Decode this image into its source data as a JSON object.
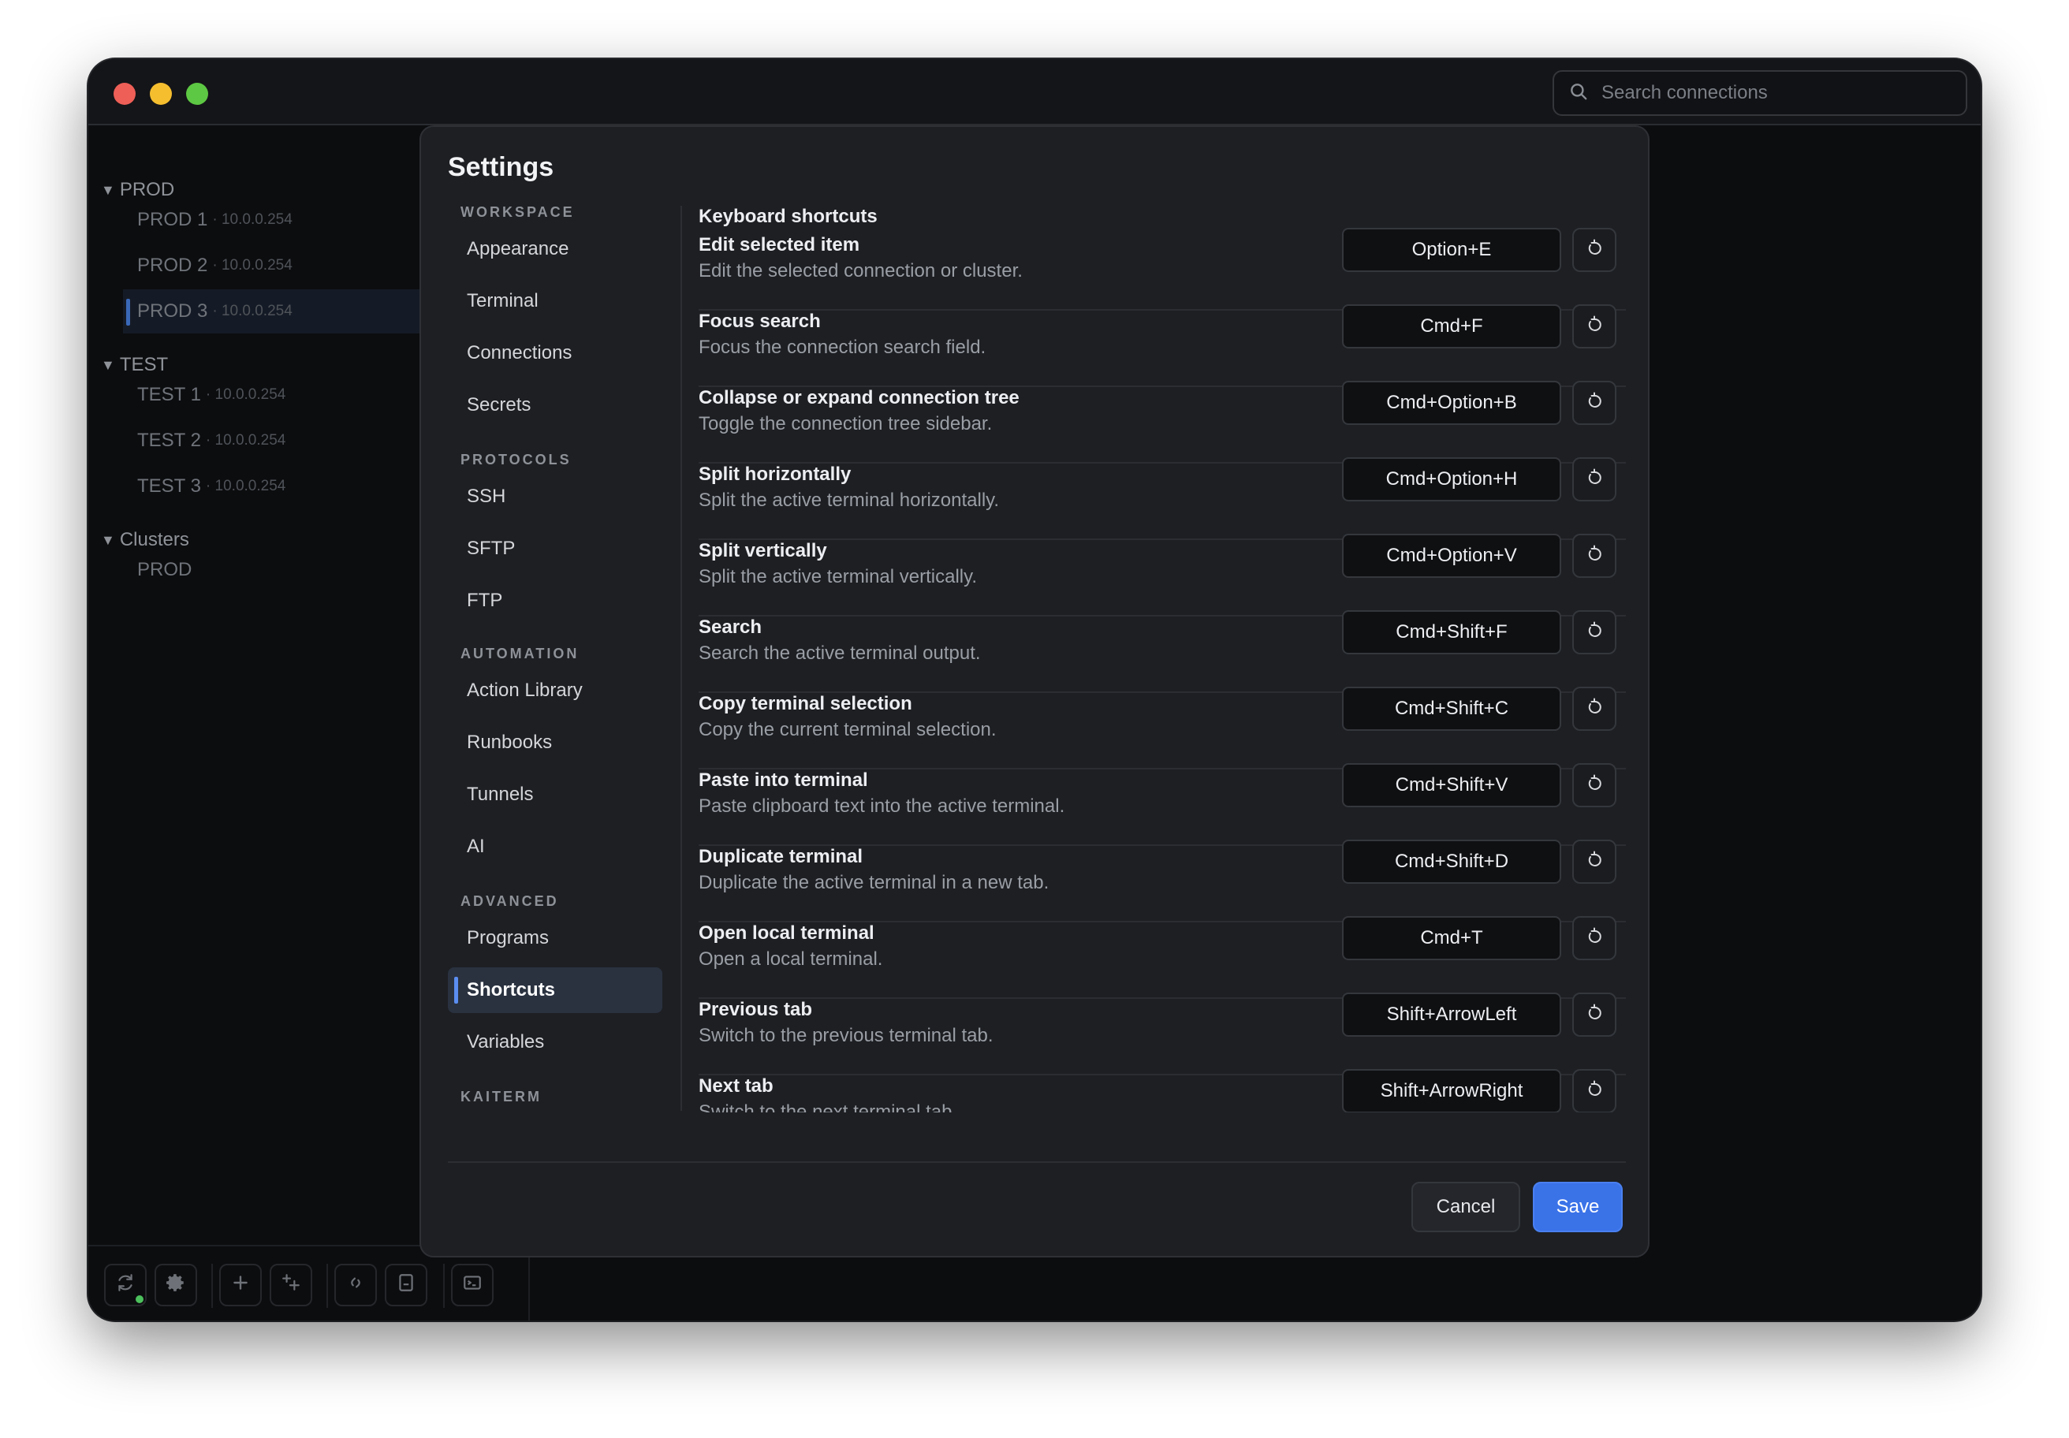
{
  "search": {
    "placeholder": "Search connections"
  },
  "tree": {
    "groups": [
      {
        "label": "PROD",
        "items": [
          {
            "name": "PROD 1",
            "ip": "· 10.0.0.254"
          },
          {
            "name": "PROD 2",
            "ip": "· 10.0.0.254"
          },
          {
            "name": "PROD 3",
            "ip": "· 10.0.0.254"
          }
        ]
      },
      {
        "label": "TEST",
        "items": [
          {
            "name": "TEST 1",
            "ip": "· 10.0.0.254"
          },
          {
            "name": "TEST 2",
            "ip": "· 10.0.0.254"
          },
          {
            "name": "TEST 3",
            "ip": "· 10.0.0.254"
          }
        ]
      },
      {
        "label": "Clusters",
        "items": [
          {
            "name": "PROD",
            "ip": ""
          }
        ]
      }
    ],
    "active_item": "PROD 3"
  },
  "settings": {
    "title": "Settings",
    "nav": {
      "workspace_label": "WORKSPACE",
      "workspace": [
        "Appearance",
        "Terminal",
        "Connections",
        "Secrets"
      ],
      "protocols_label": "PROTOCOLS",
      "protocols": [
        "SSH",
        "SFTP",
        "FTP"
      ],
      "automation_label": "AUTOMATION",
      "automation": [
        "Action Library",
        "Runbooks",
        "Tunnels",
        "AI"
      ],
      "advanced_label": "ADVANCED",
      "advanced": [
        "Programs",
        "Shortcuts",
        "Variables"
      ],
      "kaiterm_label": "KAITERM",
      "active": "Shortcuts"
    },
    "content": {
      "heading": "Keyboard shortcuts",
      "shortcuts": [
        {
          "title": "Edit selected item",
          "desc": "Edit the selected connection or cluster.",
          "key": "Option+E"
        },
        {
          "title": "Focus search",
          "desc": "Focus the connection search field.",
          "key": "Cmd+F"
        },
        {
          "title": "Collapse or expand connection tree",
          "desc": "Toggle the connection tree sidebar.",
          "key": "Cmd+Option+B"
        },
        {
          "title": "Split horizontally",
          "desc": "Split the active terminal horizontally.",
          "key": "Cmd+Option+H"
        },
        {
          "title": "Split vertically",
          "desc": "Split the active terminal vertically.",
          "key": "Cmd+Option+V"
        },
        {
          "title": "Search",
          "desc": "Search the active terminal output.",
          "key": "Cmd+Shift+F"
        },
        {
          "title": "Copy terminal selection",
          "desc": "Copy the current terminal selection.",
          "key": "Cmd+Shift+C"
        },
        {
          "title": "Paste into terminal",
          "desc": "Paste clipboard text into the active terminal.",
          "key": "Cmd+Shift+V"
        },
        {
          "title": "Duplicate terminal",
          "desc": "Duplicate the active terminal in a new tab.",
          "key": "Cmd+Shift+D"
        },
        {
          "title": "Open local terminal",
          "desc": "Open a local terminal.",
          "key": "Cmd+T"
        },
        {
          "title": "Previous tab",
          "desc": "Switch to the previous terminal tab.",
          "key": "Shift+ArrowLeft"
        },
        {
          "title": "Next tab",
          "desc": "Switch to the next terminal tab.",
          "key": "Shift+ArrowRight"
        }
      ]
    },
    "buttons": {
      "cancel": "Cancel",
      "save": "Save"
    }
  },
  "colors": {
    "accent": "#3a72e8",
    "active_indicator": "#5b8ef0",
    "status_online": "#4cc05c"
  },
  "icons": {
    "bottom_bar": [
      "sync-icon",
      "gear-icon",
      "plus-icon",
      "add-multiple-icon",
      "link-icon",
      "bookmark-icon",
      "terminal-icon"
    ],
    "reset": "reset-icon",
    "search": "search-icon"
  }
}
